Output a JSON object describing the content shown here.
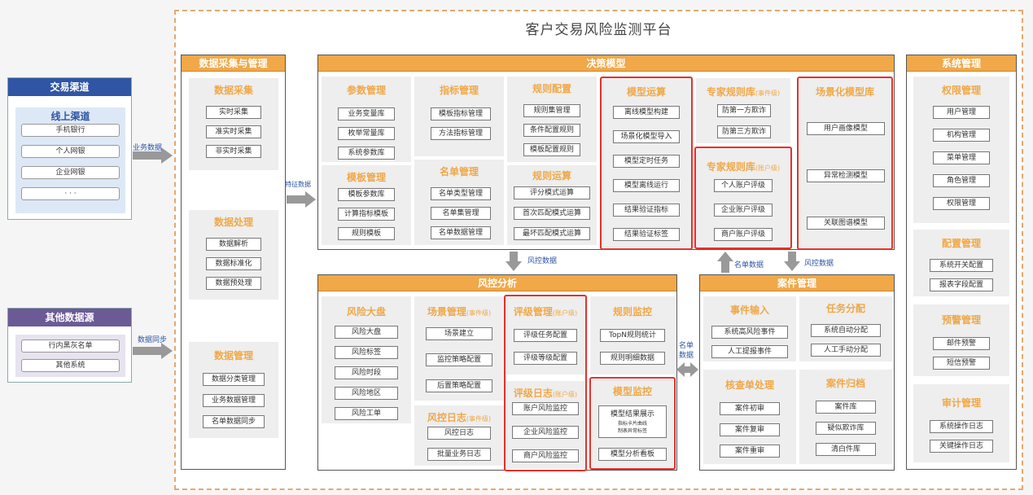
{
  "title": "客户交易风险监测平台",
  "left": {
    "trade": {
      "header": "交易渠道",
      "online": "线上渠道",
      "items": [
        "手机银行",
        "个人网银",
        "企业网银",
        "· · ·"
      ]
    },
    "other": {
      "header": "其他数据源",
      "items": [
        "行内黑灰名单",
        "其他系统"
      ]
    }
  },
  "arrows": {
    "biz_data": "业务数据",
    "data_sync": "数据同步",
    "feature": "特征数据",
    "risk1": "风控数据",
    "name_list": "名单数据",
    "risk2": "风控数据",
    "name_list2": "名单\n数据"
  },
  "collect": {
    "header": "数据采集与管理",
    "p1": {
      "title": "数据采集",
      "items": [
        "实时采集",
        "准实时采集",
        "非实时采集"
      ]
    },
    "p2": {
      "title": "数据处理",
      "items": [
        "数据解析",
        "数据标准化",
        "数据预处理"
      ]
    },
    "p3": {
      "title": "数据管理",
      "items": [
        "数据分类管理",
        "业务数据管理",
        "名单数据同步"
      ]
    }
  },
  "decision": {
    "header": "决策模型",
    "param": {
      "title": "参数管理",
      "items": [
        "业务变量库",
        "枚举常量库",
        "系统参数库"
      ]
    },
    "template": {
      "title": "模板管理",
      "items": [
        "模板参数库",
        "计算指标模板",
        "规则模板"
      ]
    },
    "indicator": {
      "title": "指标管理",
      "items": [
        "模板指标管理",
        "方法指标管理"
      ]
    },
    "namelist": {
      "title": "名单管理",
      "items": [
        "名单类型管理",
        "名单集管理",
        "名单数据管理"
      ]
    },
    "ruleconf": {
      "title": "规则配置",
      "items": [
        "规则集管理",
        "条件配置规则",
        "模板配置规则"
      ]
    },
    "rulecalc": {
      "title": "规则运算",
      "items": [
        "评分模式运算",
        "首次匹配模式运算",
        "最坏匹配模式运算"
      ]
    },
    "model": {
      "title": "模型运算",
      "items": [
        "离线模型构建",
        "场景化模型导入",
        "模型定时任务",
        "模型离线运行",
        "结果验证指标",
        "结果验证标签"
      ]
    },
    "expert1": {
      "title": "专家规则库",
      "sub": "(事件级)",
      "items": [
        "防第一方欺诈",
        "防第三方欺诈"
      ]
    },
    "expert2": {
      "title": "专家规则库",
      "sub": "(账户级)",
      "items": [
        "个人账户评级",
        "企业账户评级",
        "商户账户评级"
      ]
    },
    "scene": {
      "title": "场景化模型库",
      "items": [
        "用户画像模型",
        "异常检测模型",
        "关联图谱模型"
      ]
    }
  },
  "riskctl": {
    "header": "风控分析",
    "board": {
      "title": "风险大盘",
      "items": [
        "风险大盘",
        "风险标签",
        "风险时段",
        "风险地区",
        "风险工单"
      ]
    },
    "scene": {
      "title": "场景管理",
      "sub": "(事件级)",
      "items": [
        "场景建立",
        "监控策略配置",
        "后置策略配置"
      ]
    },
    "log1": {
      "title": "风控日志",
      "sub": "(事件级)",
      "items": [
        "风控日志",
        "批量业务日志"
      ]
    },
    "rating": {
      "title": "评级管理",
      "sub": "(账户级)",
      "items": [
        "评级任务配置",
        "评级等级配置"
      ]
    },
    "log2": {
      "title": "评级日志",
      "sub": "(账户级)",
      "items": [
        "账户风险监控",
        "企业风险监控",
        "商户风险监控"
      ]
    },
    "rulemon": {
      "title": "规则监控",
      "items": [
        "TopN规则统计",
        "规则明细数据"
      ]
    },
    "modelmon": {
      "title": "模型监控",
      "show": "模型结果展示",
      "bullets": [
        "指标卡片曲线",
        "制表异常标签"
      ],
      "board": "模型分析看板"
    }
  },
  "cases": {
    "header": "案件管理",
    "input": {
      "title": "事件输入",
      "items": [
        "系统高风险事件",
        "人工提报事件"
      ]
    },
    "assign": {
      "title": "任务分配",
      "items": [
        "系统自动分配",
        "人工手动分配"
      ]
    },
    "check": {
      "title": "核查单处理",
      "items": [
        "案件初审",
        "案件复审",
        "案件重审"
      ]
    },
    "archive": {
      "title": "案件归档",
      "items": [
        "案件库",
        "疑似欺诈库",
        "清白件库"
      ]
    }
  },
  "sys": {
    "header": "系统管理",
    "perm": {
      "title": "权限管理",
      "items": [
        "用户管理",
        "机构管理",
        "菜单管理",
        "角色管理",
        "权限管理"
      ]
    },
    "conf": {
      "title": "配置管理",
      "items": [
        "系统开关配置",
        "报表字段配置"
      ]
    },
    "warn": {
      "title": "预警管理",
      "items": [
        "邮件预警",
        "短信预警"
      ]
    },
    "audit": {
      "title": "审计管理",
      "items": [
        "系统操作日志",
        "关键操作日志"
      ]
    }
  },
  "colors": {
    "orange": "#f0a848",
    "red": "#e8302a",
    "blue": "#2f55a4",
    "purple": "#6b5a96"
  }
}
